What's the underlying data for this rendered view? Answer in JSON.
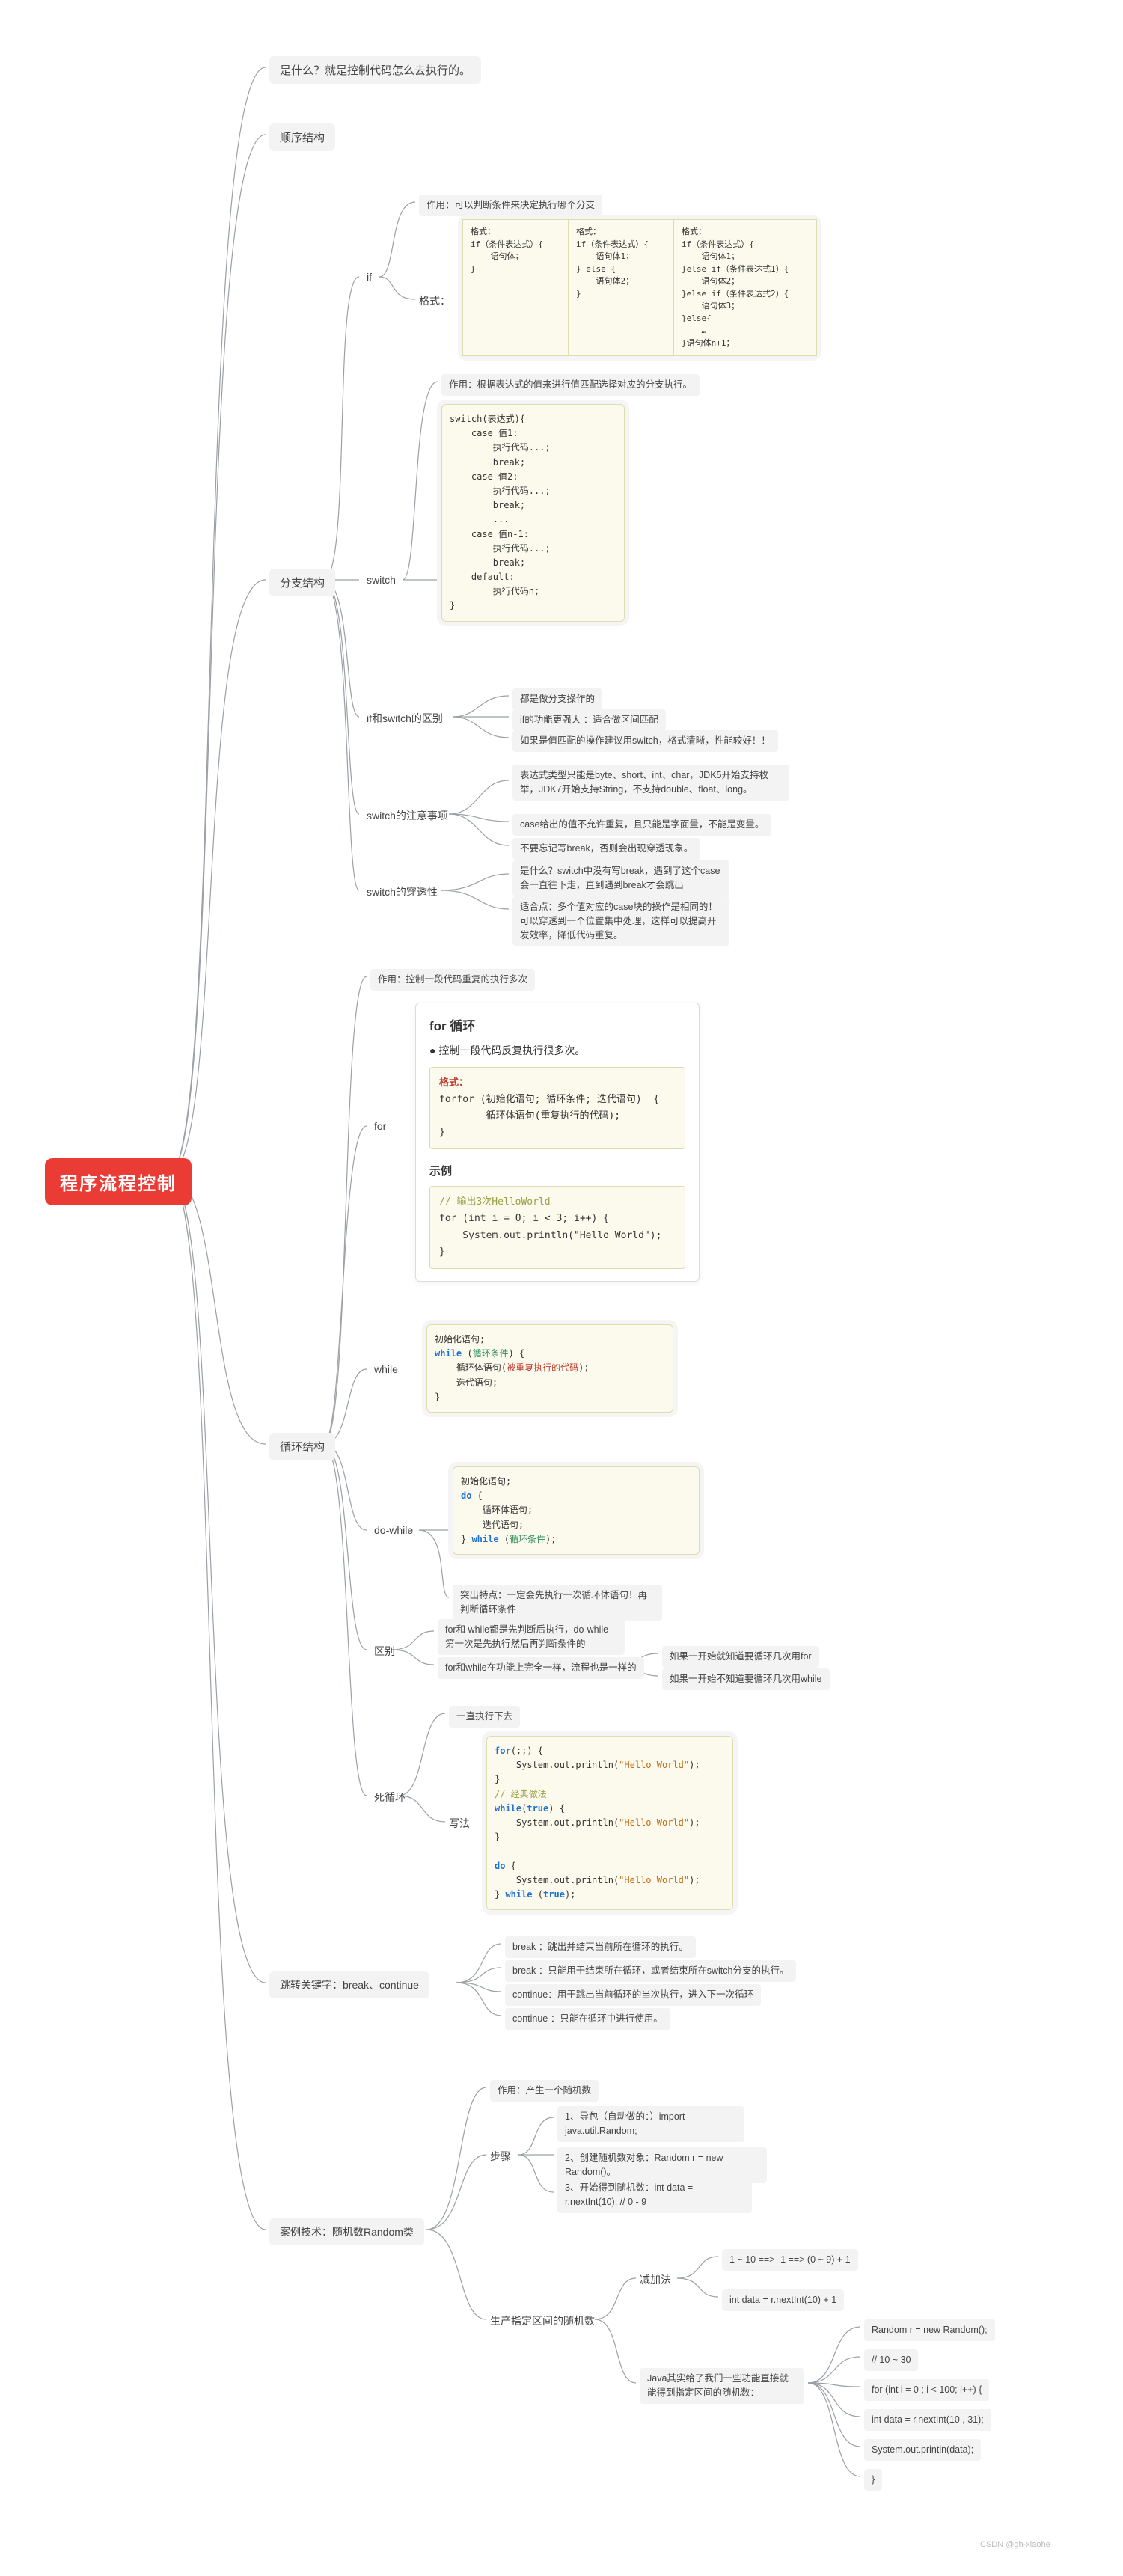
{
  "root": "程序流程控制",
  "n_what": "是什么？就是控制代码怎么去执行的。",
  "n_seq": "顺序结构",
  "n_branch": "分支结构",
  "if_label": "if",
  "if_purpose": "作用：可以判断条件来决定执行哪个分支",
  "if_fmt_label": "格式：",
  "if_fmt_col1": "格式：\nif（条件表达式）{\n    语句体；\n}",
  "if_fmt_col2": "格式：\nif（条件表达式）{\n    语句体1；\n} else {\n    语句体2；\n}",
  "if_fmt_col3": "格式：\nif（条件表达式）{\n    语句体1；\n}else if（条件表达式1）{\n    语句体2；\n}else if（条件表达式2）{\n    语句体3；\n}else{\n    …\n}语句体n+1；",
  "sw_label": "switch",
  "sw_purpose": "作用：根据表达式的值来进行值匹配选择对应的分支执行。",
  "sw_code": "switch(表达式){\n    case 值1:\n        执行代码...;\n        break;\n    case 值2:\n        执行代码...;\n        break;\n        ...\n    case 值n-1:\n        执行代码...;\n        break;\n    default:\n        执行代码n;\n}",
  "diff_label": "if和switch的区别",
  "diff_1": "都是做分支操作的",
  "diff_2": "if的功能更强大    ：适合做区间匹配",
  "diff_3": "如果是值匹配的操作建议用switch，格式清晰，性能较好！！",
  "sw_note_label": "switch的注意事项",
  "sw_note_1": "表达式类型只能是byte、short、int、char，JDK5开始支持枚举，JDK7开始支持String，不支持double、float、long。",
  "sw_note_2": "case给出的值不允许重复，且只能是字面量，不能是变量。",
  "sw_note_3": "不要忘记写break，否则会出现穿透现象。",
  "sw_pen_label": "switch的穿透性",
  "sw_pen_1": "是什么？switch中没有写break，遇到了这个case会一直往下走，直到遇到break才会跳出",
  "sw_pen_2": "适合点：多个值对应的case块的操作是相同的！可以穿透到一个位置集中处理，这样可以提高开发效率，降低代码重复。",
  "n_loop": "循环结构",
  "loop_purpose": "作用：控制一段代码重复的执行多次",
  "for_label": "for",
  "for_title": "for  循环",
  "for_bullet": "控制一段代码反复执行很多次。",
  "for_fmt_hdr": "格式：",
  "for_fmt": "for (初始化语句; 循环条件; 迭代语句)  {\n        循环体语句(重复执行的代码);\n}",
  "for_ex_label": "示例",
  "for_ex_cm": "// 输出3次HelloWorld",
  "for_ex_code": "for (int i = 0; i < 3; i++) {\n    System.out.println(\"Hello World\");\n}",
  "while_label": "while",
  "while_code": "初始化语句;\nwhile (循环条件) {\n    循环体语句(被重复执行的代码);\n    迭代语句;\n}",
  "do_label": "do-while",
  "do_code": "初始化语句;\ndo {\n    循环体语句;\n    迭代语句;\n} while (循环条件);",
  "do_note": "突出特点：一定会先执行一次循环体语句！再判断循环条件",
  "rel_label": "区别",
  "rel_1": "for和 while都是先判断后执行，do-while第一次是先执行然后再判断条件的",
  "rel_2_label": "for和while在功能上完全一样，流程也是一样的",
  "rel_2a": "如果一开始就知道要循环几次用for",
  "rel_2b": "如果一开始不知道要循环几次用while",
  "dead_label": "死循环",
  "dead_1": "一直执行下去",
  "dead_w_label": "写法",
  "dead_code": "for(;;) {\n    System.out.println(\"Hello World\");\n}\n// 经典做法\nwhile(true) {\n    System.out.println(\"Hello World\");\n}\n\ndo {\n    System.out.println(\"Hello World\");\n} while (true);",
  "n_jump": "跳转关键字：break、continue",
  "jump_1": "break  ：跳出并结束当前所在循环的执行。",
  "jump_2": "break ：只能用于结束所在循环，或者结束所在switch分支的执行。",
  "jump_3": "continue：用于跳出当前循环的当次执行，进入下一次循环",
  "jump_4": "continue ：只能在循环中进行使用。",
  "n_rand": "案例技术：随机数Random类",
  "r_purpose": "作用：产生一个随机数",
  "r_step_label": "步骤",
  "r_step_1": "1、导包（自动做的：）import java.util.Random;",
  "r_step_2": "2、创建随机数对象：Random r = new Random()。",
  "r_step_3": "3、开始得到随机数：int data = r.nextInt(10); // 0 - 9",
  "r_range_label": "生产指定区间的随机数",
  "r_sub_label": "减加法",
  "r_sub_1": "1 ~ 10   ==> -1 ==>  (0 ~ 9) + 1",
  "r_sub_2": "int data = r.nextInt(10) + 1",
  "r_java_label": "Java其实给了我们一些功能直接就能得到指定区间的随机数：",
  "r_java_1": "Random r = new Random();",
  "r_java_2": "// 10 ~ 30",
  "r_java_3": "for (int i = 0 ; i < 100; i++) {",
  "r_java_4": "    int data = r.nextInt(10 , 31);",
  "r_java_5": "    System.out.println(data);",
  "r_java_6": "}",
  "footer": "CSDN @gh-xiaohe"
}
